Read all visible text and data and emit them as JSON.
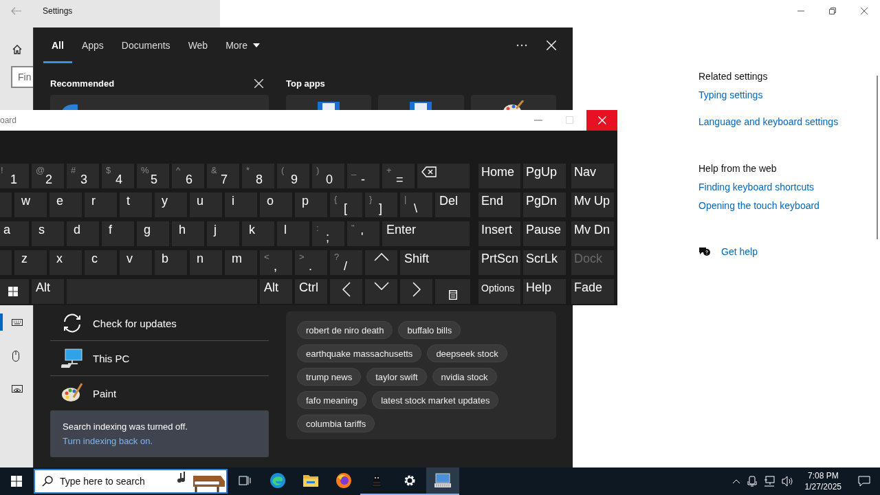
{
  "settings": {
    "title": "Settings",
    "search_placeholder": "Fin",
    "nav": [
      {
        "kind": "keyboard",
        "selected": true
      },
      {
        "kind": "mouse",
        "selected": false
      },
      {
        "kind": "eye-control",
        "selected": false
      }
    ],
    "related_heading": "Related settings",
    "related_links": [
      "Typing settings",
      "Language and keyboard settings"
    ],
    "help_heading": "Help from the web",
    "help_links": [
      "Finding keyboard shortcuts",
      "Opening the touch keyboard"
    ],
    "get_help": "Get help"
  },
  "search_flyout": {
    "tabs": [
      {
        "label": "All",
        "selected": true
      },
      {
        "label": "Apps",
        "selected": false
      },
      {
        "label": "Documents",
        "selected": false
      },
      {
        "label": "Web",
        "selected": false
      },
      {
        "label": "More",
        "selected": false
      }
    ],
    "recommended_heading": "Recommended",
    "top_apps_heading": "Top apps",
    "top_apps": [
      {
        "kind": "document"
      },
      {
        "kind": "document"
      },
      {
        "kind": "paint"
      }
    ],
    "results": [
      {
        "kind": "update",
        "label": "Check for updates"
      },
      {
        "kind": "pc",
        "label": "This PC"
      },
      {
        "kind": "paint",
        "label": "Paint"
      }
    ],
    "notice": {
      "text": "Search indexing was turned off.",
      "link": "Turn indexing back on."
    },
    "trending": [
      "robert de niro death",
      "buffalo bills",
      "earthquake massachusetts",
      "deepseek stock",
      "trump news",
      "taylor swift",
      "nvidia stock",
      "fafo meaning",
      "latest stock market updates",
      "columbia tariffs"
    ]
  },
  "keyboard": {
    "title": "oard",
    "main_rows": [
      [
        {
          "kind": "symbol",
          "shift": "!",
          "label": "1"
        },
        {
          "kind": "symbol",
          "shift": "@",
          "label": "2"
        },
        {
          "kind": "symbol",
          "shift": "#",
          "label": "3"
        },
        {
          "kind": "symbol",
          "shift": "$",
          "label": "4"
        },
        {
          "kind": "symbol",
          "shift": "%",
          "label": "5"
        },
        {
          "kind": "symbol",
          "shift": "^",
          "label": "6"
        },
        {
          "kind": "symbol",
          "shift": "&",
          "label": "7"
        },
        {
          "kind": "symbol",
          "shift": "*",
          "label": "8"
        },
        {
          "kind": "symbol",
          "shift": "(",
          "label": "9"
        },
        {
          "kind": "symbol",
          "shift": ")",
          "label": "0"
        },
        {
          "kind": "symbol",
          "shift": "_",
          "label": "-"
        },
        {
          "kind": "symbol",
          "shift": "+",
          "label": "="
        },
        {
          "kind": "backspace"
        }
      ],
      [
        {
          "kind": "blank"
        },
        {
          "kind": "letter",
          "label": "w"
        },
        {
          "kind": "letter",
          "label": "e"
        },
        {
          "kind": "letter",
          "label": "r"
        },
        {
          "kind": "letter",
          "label": "t"
        },
        {
          "kind": "letter",
          "label": "y"
        },
        {
          "kind": "letter",
          "label": "u"
        },
        {
          "kind": "letter",
          "label": "i"
        },
        {
          "kind": "letter",
          "label": "o"
        },
        {
          "kind": "letter",
          "label": "p"
        },
        {
          "kind": "symbol",
          "shift": "{",
          "label": "["
        },
        {
          "kind": "symbol",
          "shift": "}",
          "label": "]"
        },
        {
          "kind": "symbol",
          "shift": "|",
          "label": "\\"
        },
        {
          "kind": "del",
          "label": "Del"
        }
      ],
      [
        {
          "kind": "letter",
          "label": "a"
        },
        {
          "kind": "letter",
          "label": "s"
        },
        {
          "kind": "letter",
          "label": "d"
        },
        {
          "kind": "letter",
          "label": "f"
        },
        {
          "kind": "letter",
          "label": "g"
        },
        {
          "kind": "letter",
          "label": "h"
        },
        {
          "kind": "letter",
          "label": "j"
        },
        {
          "kind": "letter",
          "label": "k"
        },
        {
          "kind": "letter",
          "label": "l"
        },
        {
          "kind": "symbol",
          "shift": ":",
          "label": ";"
        },
        {
          "kind": "symbol",
          "shift": "\"",
          "label": "'"
        },
        {
          "kind": "enter",
          "label": "Enter"
        }
      ],
      [
        {
          "kind": "blank"
        },
        {
          "kind": "letter",
          "label": "z"
        },
        {
          "kind": "letter",
          "label": "x"
        },
        {
          "kind": "letter",
          "label": "c"
        },
        {
          "kind": "letter",
          "label": "v"
        },
        {
          "kind": "letter",
          "label": "b"
        },
        {
          "kind": "letter",
          "label": "n"
        },
        {
          "kind": "letter",
          "label": "m"
        },
        {
          "kind": "symbol",
          "shift": "<",
          "label": ","
        },
        {
          "kind": "symbol",
          "shift": ">",
          "label": "."
        },
        {
          "kind": "symbol",
          "shift": "?",
          "label": "/"
        },
        {
          "kind": "arrow-up"
        },
        {
          "kind": "shift",
          "label": "Shift"
        }
      ],
      [
        {
          "kind": "win"
        },
        {
          "kind": "mod",
          "label": "Alt"
        },
        {
          "kind": "space"
        },
        {
          "kind": "mod",
          "label": "Alt"
        },
        {
          "kind": "mod",
          "label": "Ctrl"
        },
        {
          "kind": "arrow-left"
        },
        {
          "kind": "arrow-down"
        },
        {
          "kind": "arrow-right"
        },
        {
          "kind": "menu"
        }
      ]
    ],
    "nav_keys": [
      {
        "label": "Home",
        "disabled": false
      },
      {
        "label": "PgUp",
        "disabled": false
      },
      {
        "label": "Nav",
        "disabled": false
      },
      {
        "label": "End",
        "disabled": false
      },
      {
        "label": "PgDn",
        "disabled": false
      },
      {
        "label": "Mv Up",
        "disabled": false
      },
      {
        "label": "Insert",
        "disabled": false
      },
      {
        "label": "Pause",
        "disabled": false
      },
      {
        "label": "Mv Dn",
        "disabled": false
      },
      {
        "label": "PrtScn",
        "disabled": false
      },
      {
        "label": "ScrLk",
        "disabled": false
      },
      {
        "label": "Dock",
        "disabled": true
      },
      {
        "label": "Options",
        "disabled": false
      },
      {
        "label": "Help",
        "disabled": false
      },
      {
        "label": "Fade",
        "disabled": false
      }
    ]
  },
  "taskbar": {
    "search_placeholder": "Type here to search",
    "apps": [
      {
        "kind": "task-view",
        "active": false,
        "selected": false
      },
      {
        "kind": "edge",
        "active": false,
        "selected": false
      },
      {
        "kind": "explorer",
        "active": false,
        "selected": false
      },
      {
        "kind": "firefox",
        "active": false,
        "selected": false
      },
      {
        "kind": "dark-app",
        "active": true,
        "selected": false
      },
      {
        "kind": "settings",
        "active": true,
        "selected": false
      },
      {
        "kind": "keyboard",
        "active": true,
        "selected": true
      }
    ],
    "time": "7:08 PM",
    "date": "1/27/2025"
  }
}
